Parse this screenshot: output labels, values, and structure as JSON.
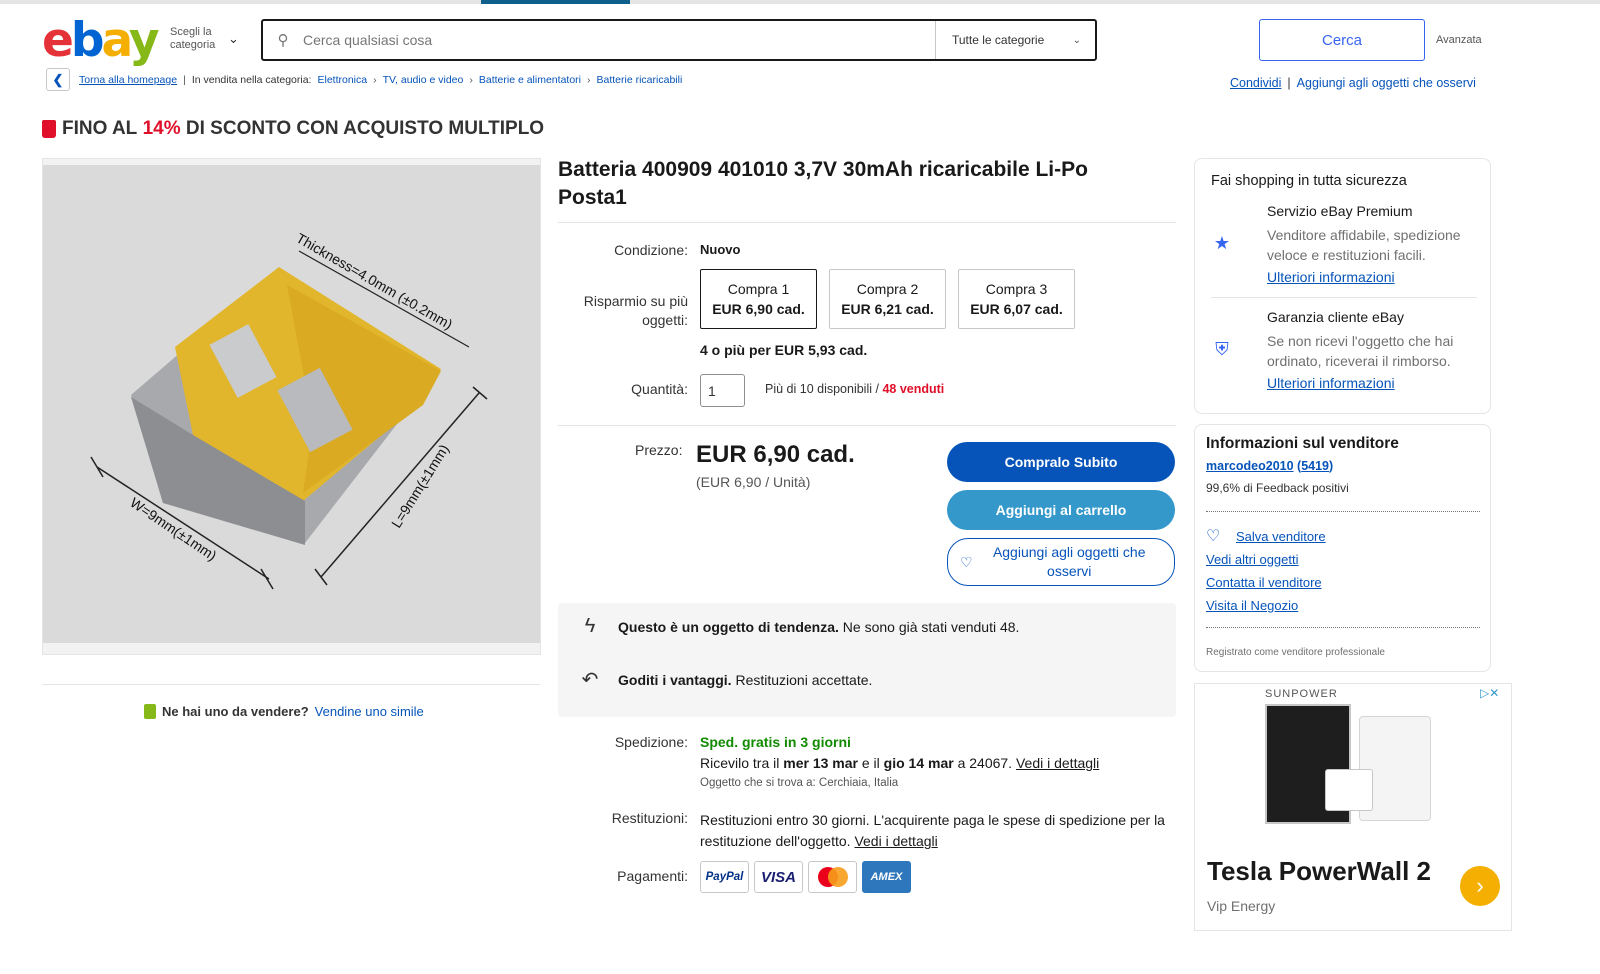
{
  "header": {
    "logo_letters": [
      "e",
      "b",
      "a",
      "y"
    ],
    "category_button": "Scegli la categoria",
    "search_placeholder": "Cerca qualsiasi cosa",
    "category_select": "Tutte le categorie",
    "search_button": "Cerca",
    "advanced": "Avanzata"
  },
  "breadcrumb": {
    "back_home": "Torna alla homepage",
    "in_category": "In vendita nella categoria:",
    "items": [
      "Elettronica",
      "TV, audio e video",
      "Batterie e alimentatori",
      "Batterie ricaricabili"
    ]
  },
  "actions": {
    "share": "Condividi",
    "watch": "Aggiungi agli oggetti che osservi"
  },
  "promo": {
    "prefix": "FINO AL",
    "percent": "14%",
    "suffix": "DI SCONTO CON ACQUISTO MULTIPLO"
  },
  "product_image": {
    "thickness": "Thickness=4.0mm (±0.2mm)",
    "length": "L=9mm(±1mm)",
    "width": "W=9mm(±1mm)"
  },
  "sell_prompt": {
    "question": "Ne hai uno da vendere?",
    "link": "Vendine uno simile"
  },
  "product": {
    "title": "Batteria 400909 401010 3,7V 30mAh ricaricabile Li-Po Posta1",
    "condition_label": "Condizione:",
    "condition": "Nuovo",
    "savings_label": "Risparmio su più oggetti:",
    "variants": [
      {
        "label": "Compra 1",
        "price": "EUR 6,90 cad."
      },
      {
        "label": "Compra 2",
        "price": "EUR 6,21 cad."
      },
      {
        "label": "Compra 3",
        "price": "EUR 6,07 cad."
      }
    ],
    "more": "4 o più per EUR 5,93 cad.",
    "quantity_label": "Quantità:",
    "quantity": "1",
    "available": "Più di 10 disponibili",
    "sold": "48 venduti",
    "price_label": "Prezzo:",
    "price": "EUR 6,90 cad.",
    "unit_price": "(EUR 6,90 / Unità)",
    "buy_now": "Compralo Subito",
    "add_cart": "Aggiungi al carrello",
    "add_watch": "Aggiungi agli oggetti che osservi"
  },
  "highlights": [
    {
      "bold": "Questo è un oggetto di tendenza.",
      "text": "Ne sono già stati venduti 48."
    },
    {
      "bold": "Goditi i vantaggi.",
      "text": "Restituzioni accettate."
    }
  ],
  "shipping": {
    "label": "Spedizione:",
    "free": "Sped. gratis in 3 giorni",
    "receive_prefix": "Ricevilo tra il",
    "date1": "mer 13 mar",
    "and": "e il",
    "date2": "gio 14 mar",
    "to": "a 24067.",
    "details": "Vedi i dettagli",
    "location": "Oggetto che si trova a: Cerchiaia, Italia"
  },
  "returns": {
    "label": "Restituzioni:",
    "text": "Restituzioni entro 30 giorni. L'acquirente paga le spese di spedizione per la restituzione dell'oggetto.",
    "details": "Vedi i dettagli"
  },
  "payments": {
    "label": "Pagamenti:",
    "cards": [
      "PayPal",
      "VISA",
      "Mastercard",
      "AMEX"
    ]
  },
  "safety": {
    "title": "Fai shopping in tutta sicurezza",
    "items": [
      {
        "title": "Servizio eBay Premium",
        "desc": "Venditore affidabile, spedizione veloce e restituzioni facili.",
        "link": "Ulteriori informazioni"
      },
      {
        "title": "Garanzia cliente eBay",
        "desc": "Se non ricevi l'oggetto che hai ordinato, riceverai il rimborso.",
        "link": "Ulteriori informazioni"
      }
    ]
  },
  "seller": {
    "title": "Informazioni sul venditore",
    "name": "marcodeo2010",
    "score": "5419",
    "feedback": "99,6% di Feedback positivi",
    "save": "Salva venditore",
    "other_items": "Vedi altri oggetti",
    "contact": "Contatta il venditore",
    "store": "Visita il Negozio",
    "registered": "Registrato come venditore professionale"
  },
  "ad": {
    "brand": "SUNPOWER",
    "headline": "Tesla PowerWall 2",
    "advertiser": "Vip Energy"
  },
  "colors": {
    "ebay_red": "#e53238",
    "ebay_blue": "#0064d2",
    "ebay_yellow": "#f5af02",
    "ebay_green": "#86b817",
    "primary_button": "#0654ba",
    "cart_button": "#3498ca",
    "free_shipping": "#118a00",
    "discount_red": "#e0102a"
  }
}
